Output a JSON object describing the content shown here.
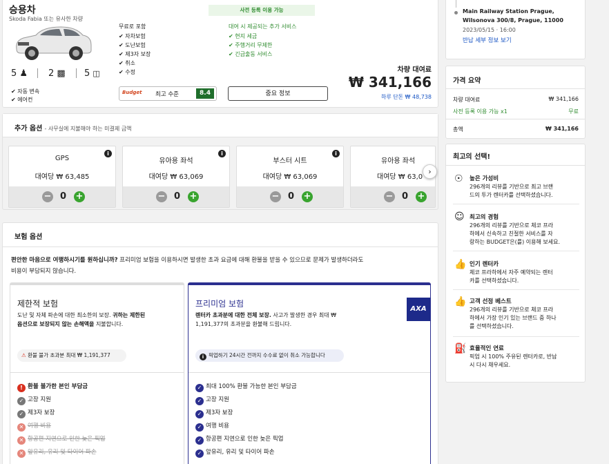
{
  "car": {
    "category": "승용차",
    "model": "Skoda Fabia 또는 유사한 차량",
    "seats": "5",
    "bags": "2",
    "doors": "5",
    "features": [
      "자동 변속",
      "에어컨"
    ],
    "included_title": "무료로 포함",
    "included": [
      "자차보험",
      "도난보험",
      "제3자 보장",
      "취소",
      "수정"
    ],
    "advance_badge": "사전 등록 이용 가능",
    "extra_title": "대여 시 제공되는 추가 서비스",
    "extras": [
      "현지 세금",
      "주행거리 무제한",
      "긴급출동 서비스"
    ],
    "supplier_logo": "Budget",
    "supplier_label": "최고 수준",
    "rating": "8.4",
    "important_info_button": "중요 정보",
    "price_label": "차량 대여료",
    "price": "₩ 341,166",
    "per_day": "하루 단돈 ₩ 48,738"
  },
  "addons": {
    "title": "추가 옵션",
    "subtitle": "- 사무실에 지불해야 하는 미결제 금액",
    "items": [
      {
        "name": "GPS",
        "price": "대여당 ₩ 63,485",
        "qty": "0"
      },
      {
        "name": "유아용 좌석",
        "price": "대여당 ₩ 63,069",
        "qty": "0"
      },
      {
        "name": "부스터 시트",
        "price": "대여당 ₩ 63,069",
        "qty": "0"
      },
      {
        "name": "유아용 좌석",
        "price": "대여당 ₩ 63,0",
        "qty": "0"
      }
    ]
  },
  "insurance": {
    "title": "보험 옵션",
    "intro_bold": "편안한 마음으로 여행하시기를 원하십니까?",
    "intro_rest": " 프리미엄 보험을 이용하시면 발생한 초과 요금에 대해 환불을 받을 수 있으므로 문제가 발생하더라도",
    "intro_line2": "비용이 부담되지 않습니다.",
    "limited": {
      "title": "제한적 보험",
      "desc_line1_a": "도난 및 자체 파손에 대한 최소한의 보장. ",
      "desc_line1_b": "귀하는 제한된",
      "desc_line2_a": "옵션으로 보장되지 않는 손해액을",
      "desc_line2_b": " 지불합니다.",
      "warning": "환불 불가 초과분 최대 ₩ 1,191,377",
      "items": [
        "환불 불가한 본인 부담금",
        "고장 지원",
        "제3자 보장",
        "여행 비용",
        "항공편 지연으로 인한 늦은 픽업",
        "앞유리, 유리 및 타이어 파손"
      ]
    },
    "premium": {
      "title": "프리미엄 보험",
      "desc_line1_a": "렌터카 초과분에 대한 전체 보장.",
      "desc_line1_b": " 사고가 발생한 경우 최대 ₩",
      "desc_line2": "1,191,377의 초과분을 환불해 드립니다.",
      "notice": "픽업하기 24시간 전까지 수수료 없이 취소 가능합니다",
      "items": [
        "최대 100% 환불 가능한 본인 부담금",
        "고장 지원",
        "제3자 보장",
        "여행 비용",
        "항공편 지연으로 인한 늦은 픽업",
        "앞유리, 유리 및 타이어 파손"
      ],
      "logo": "AXA"
    }
  },
  "sidebar": {
    "return_location_line1": "Main Railway Station Prague,",
    "return_location_line2": "Wilsonova 300/8, Prague, 11000",
    "return_datetime": "2023/05/15 · 16:00",
    "return_details_link": "반납 세부 정보 보기",
    "price_summary": {
      "title": "가격 요약",
      "rows": [
        {
          "label": "차량 대여료",
          "value": "₩ 341,166"
        },
        {
          "label": "사전 등록 이용 가능 x1",
          "value": "무료"
        }
      ],
      "total_label": "총액",
      "total_value": "₩ 341,166"
    },
    "best_choice": {
      "title": "최고의 선택!",
      "items": [
        {
          "icon": "thumbs-up-medal-icon",
          "title": "높은 가성비",
          "lines": [
            "296개의 리뷰를 기반으로 최고 브랜",
            "드의 투가 렌터카를 선택하셨습니다."
          ]
        },
        {
          "icon": "person-badge-icon",
          "title": "최고의 경험",
          "lines": [
            "296개의 리뷰를 기반으로 체코 프라",
            "하에서 신속하고 친절한 서비스를 자",
            "랑하는 BUDGET은(를) 이용해 보세요."
          ]
        },
        {
          "icon": "thumbs-up-icon",
          "title": "인기 렌터카",
          "lines": [
            "체코 프라하에서 자주 예약되는 렌터",
            "카를 선택하셨습니다."
          ]
        },
        {
          "icon": "thumbs-up-icon",
          "title": "고객 선정 베스트",
          "lines": [
            "296개의 리뷰를 기반으로 체코 프라",
            "하에서 가장 인기 있는 브랜드 중 하나",
            "를 선택하셨습니다."
          ]
        },
        {
          "icon": "fuel-pump-icon",
          "title": "효율적인 연료",
          "lines": [
            "픽업 시 100% 주유된 렌터카로, 반납",
            "시 다시 채우세요."
          ]
        }
      ]
    }
  },
  "colors": {
    "green": "#2e8b2e",
    "blue": "#1a56c4",
    "premium_border": "#2b2f8f",
    "rating_bg": "#1f6e2b"
  }
}
